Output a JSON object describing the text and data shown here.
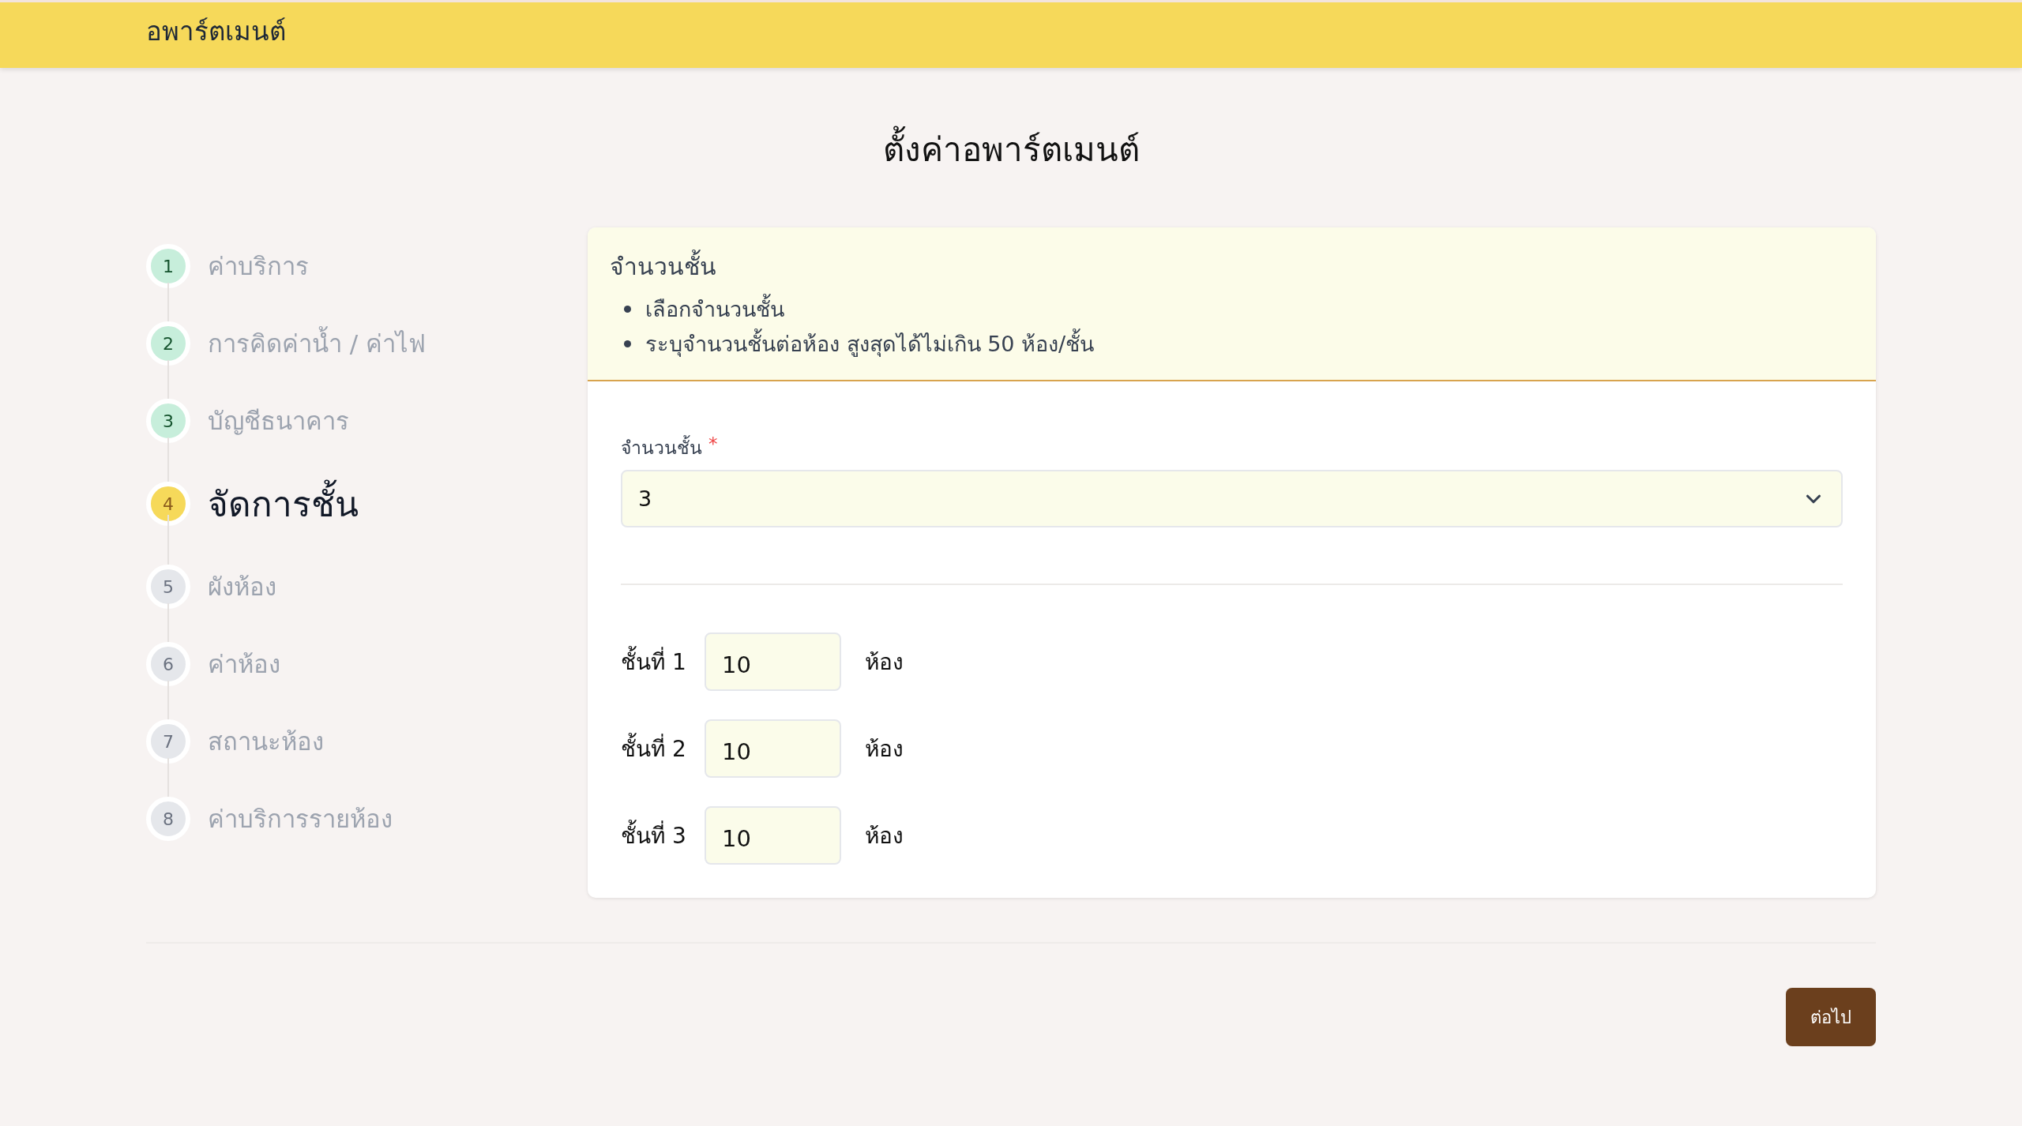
{
  "header": {
    "brand": "อพาร์ตเมนต์"
  },
  "page_title": "ตั้งค่าอพาร์ตเมนต์",
  "steps": [
    {
      "number": "1",
      "label": "ค่าบริการ",
      "completed": true,
      "selected": false
    },
    {
      "number": "2",
      "label": "การคิดค่าน้ำ / ค่าไฟ",
      "completed": true,
      "selected": false
    },
    {
      "number": "3",
      "label": "บัญชีธนาคาร",
      "completed": true,
      "selected": false
    },
    {
      "number": "4",
      "label": "จัดการชั้น",
      "completed": false,
      "selected": true
    },
    {
      "number": "5",
      "label": "ผังห้อง",
      "completed": false,
      "selected": false
    },
    {
      "number": "6",
      "label": "ค่าห้อง",
      "completed": false,
      "selected": false
    },
    {
      "number": "7",
      "label": "สถานะห้อง",
      "completed": false,
      "selected": false
    },
    {
      "number": "8",
      "label": "ค่าบริการรายห้อง",
      "completed": false,
      "selected": false
    }
  ],
  "info": {
    "title": "จำนวนชั้น",
    "bullets": [
      "เลือกจำนวนชั้น",
      "ระบุจำนวนชั้นต่อห้อง สูงสุดได้ไม่เกิน 50 ห้อง/ชั้น"
    ]
  },
  "floor_count": {
    "label": "จำนวนชั้น",
    "required_mark": "*",
    "value": "3"
  },
  "floors": [
    {
      "label": "ชั้นที่ 1",
      "value": "10",
      "unit": "ห้อง"
    },
    {
      "label": "ชั้นที่ 2",
      "value": "10",
      "unit": "ห้อง"
    },
    {
      "label": "ชั้นที่ 3",
      "value": "10",
      "unit": "ห้อง"
    }
  ],
  "next_button": "ต่อไป"
}
